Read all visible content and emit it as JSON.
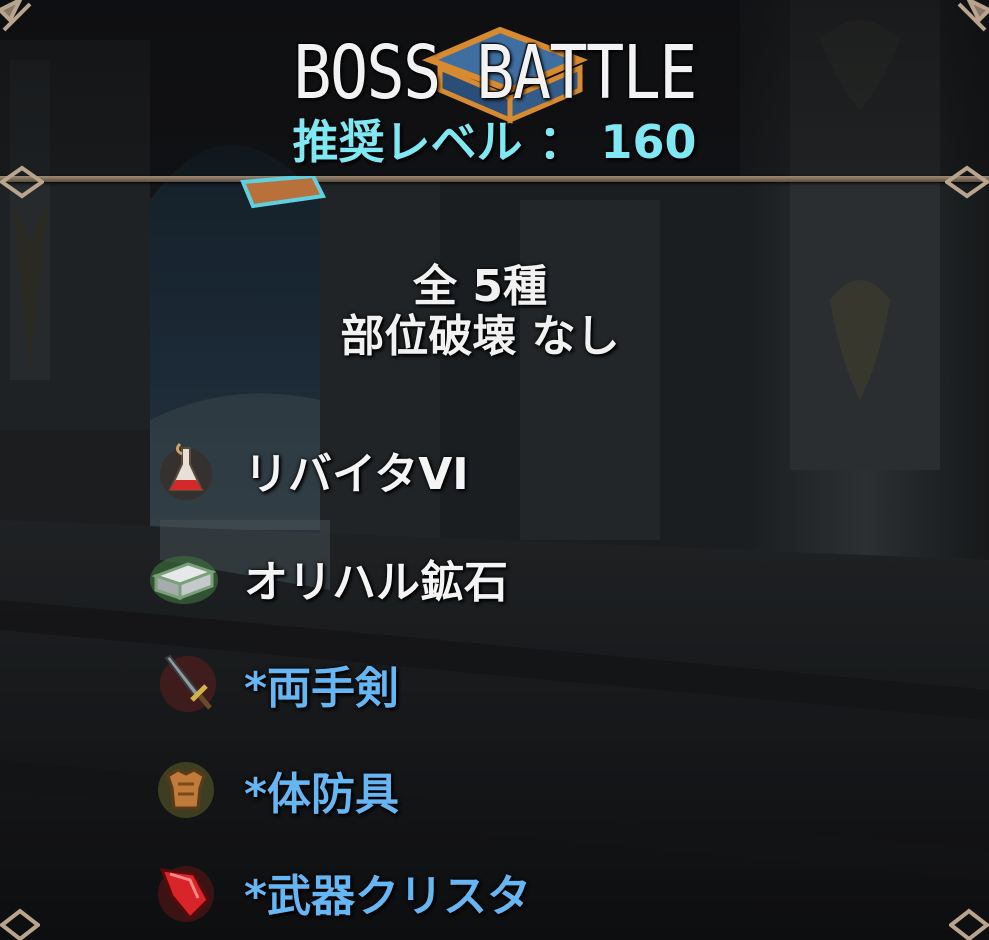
{
  "header": {
    "title": "BOSS BATTLE",
    "recommended_level": "推奨レベル ： 160"
  },
  "drop_info": {
    "count": "全 5種",
    "part_breakage": "部位破壊 なし"
  },
  "drops": [
    {
      "icon": "potion-icon",
      "label": "リバイタVI",
      "style": "normal"
    },
    {
      "icon": "ingot-icon",
      "label": "オリハル鉱石",
      "style": "normal"
    },
    {
      "icon": "sword-icon",
      "label": "*両手剣",
      "style": "equipment"
    },
    {
      "icon": "armor-icon",
      "label": "*体防具",
      "style": "equipment"
    },
    {
      "icon": "crystal-icon",
      "label": "*武器クリスタ",
      "style": "equipment"
    }
  ],
  "colors": {
    "level_text": "#7fe8f2",
    "equipment_text": "#67b6f4",
    "divider": "#9d8b75"
  }
}
